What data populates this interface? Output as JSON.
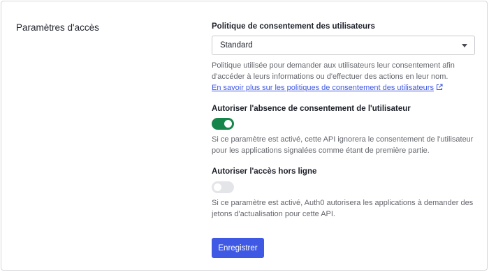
{
  "section": {
    "title": "Paramètres d'accès"
  },
  "consent_policy": {
    "label": "Politique de consentement des utilisateurs",
    "selected": "Standard",
    "help_line1": "Politique utilisée pour demander aux utilisateurs leur consentement afin",
    "help_line2": "d'accéder à leurs informations ou d'effectuer des actions en leur nom.",
    "link_text": "En savoir plus sur les politiques de consentement des utilisateurs"
  },
  "skip_consent": {
    "label": "Autoriser l'absence de consentement de l'utilisateur",
    "enabled": true,
    "help_line1": "Si ce paramètre est activé, cette API ignorera le consentement de l'utilisateur",
    "help_line2": "pour les applications signalées comme étant de première partie."
  },
  "offline_access": {
    "label": "Autoriser l'accès hors ligne",
    "enabled": false,
    "help_line1": "Si ce paramètre est activé, Auth0 autorisera les applications à demander des",
    "help_line2": "jetons d'actualisation pour cette API."
  },
  "actions": {
    "save_label": "Enregistrer"
  },
  "colors": {
    "accent": "#3f59e4",
    "toggle_on": "#16854a",
    "toggle_off": "#e4e5e8"
  },
  "icons": {
    "dropdown": "chevron-down-icon",
    "external_link": "external-link-icon"
  }
}
